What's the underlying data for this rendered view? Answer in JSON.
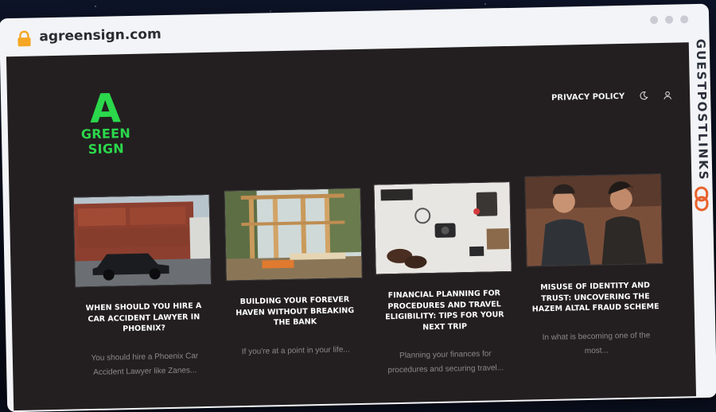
{
  "browser": {
    "url": "agreensign.com",
    "lock_icon": "lock-icon",
    "colors": {
      "lock": "#f5a623",
      "chrome": "#f3f4f7"
    }
  },
  "site": {
    "logo_letter": "A",
    "logo_text": "GREEN SIGN",
    "brand_color": "#2bd84b",
    "background": "#231f20",
    "nav": {
      "privacy_label": "PRIVACY POLICY",
      "theme_icon": "moon-icon",
      "account_icon": "user-icon"
    }
  },
  "posts": [
    {
      "title": "WHEN SHOULD YOU HIRE A CAR ACCIDENT LAWYER IN PHOENIX?",
      "excerpt": "You should hire a Phoenix Car Accident Lawyer like Zanes..."
    },
    {
      "title": "BUILDING YOUR FOREVER HAVEN WITHOUT BREAKING THE BANK",
      "excerpt": "If you're at a point in your life..."
    },
    {
      "title": "FINANCIAL PLANNING FOR PROCEDURES AND TRAVEL ELIGIBILITY: TIPS FOR YOUR NEXT TRIP",
      "excerpt": "Planning your finances for procedures and securing travel..."
    },
    {
      "title": "MISUSE OF IDENTITY AND TRUST: UNCOVERING THE HAZEM ALTAL FRAUD SCHEME",
      "excerpt": "In what is becoming one of the most..."
    }
  ],
  "watermark": {
    "text": "GUESTPOSTLINKS",
    "icon": "chain-link-icon",
    "accent": "#e8622c"
  }
}
